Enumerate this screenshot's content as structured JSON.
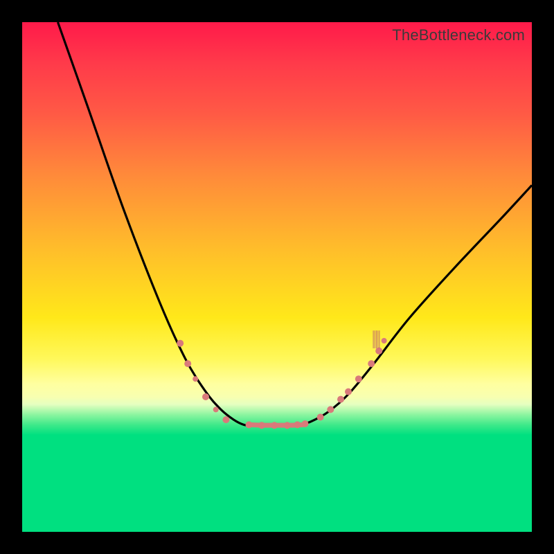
{
  "watermark": "TheBottleneck.com",
  "colors": {
    "gradient_top": "#ff1a4a",
    "gradient_mid": "#ffe81a",
    "gradient_bottom": "#00e080",
    "dot": "#d97a7a",
    "curve": "#000000",
    "frame": "#000000"
  },
  "chart_data": {
    "type": "line",
    "title": "",
    "xlabel": "",
    "ylabel": "",
    "xlim": [
      0,
      100
    ],
    "ylim": [
      0,
      100
    ],
    "note": "Axes are percentage of plot area: x left→right 0..100, y top→bottom 0..100. Higher y = lower on screen. V-shaped bottleneck curve; valley floor ≈ y 79.",
    "series": [
      {
        "name": "left-arm",
        "x": [
          7,
          13,
          20,
          27,
          32,
          36,
          39,
          41.5,
          43.5,
          45
        ],
        "y": [
          0,
          17,
          37,
          55,
          66,
          72.5,
          76,
          78,
          79,
          79
        ]
      },
      {
        "name": "valley-flat",
        "x": [
          45,
          47,
          49,
          51,
          53,
          55
        ],
        "y": [
          79,
          79.1,
          79.1,
          79.1,
          79.1,
          79
        ]
      },
      {
        "name": "right-arm",
        "x": [
          55,
          57,
          60,
          64,
          69,
          76,
          85,
          94,
          100
        ],
        "y": [
          79,
          78.2,
          76.5,
          73,
          67,
          58,
          48,
          38.5,
          32
        ]
      }
    ],
    "dots_left": [
      {
        "x": 31.0,
        "y": 63.0,
        "r": 5
      },
      {
        "x": 32.5,
        "y": 67.0,
        "r": 5
      },
      {
        "x": 34.0,
        "y": 70.0,
        "r": 4
      },
      {
        "x": 36.0,
        "y": 73.5,
        "r": 5
      },
      {
        "x": 38.0,
        "y": 76.0,
        "r": 4
      },
      {
        "x": 40.0,
        "y": 78.0,
        "r": 5
      }
    ],
    "dots_right": [
      {
        "x": 58.5,
        "y": 77.5,
        "r": 5
      },
      {
        "x": 60.5,
        "y": 76.0,
        "r": 5
      },
      {
        "x": 62.5,
        "y": 74.0,
        "r": 5
      },
      {
        "x": 64.0,
        "y": 72.5,
        "r": 5
      },
      {
        "x": 66.0,
        "y": 70.0,
        "r": 5
      },
      {
        "x": 68.5,
        "y": 67.0,
        "r": 5
      },
      {
        "x": 70.0,
        "y": 64.5,
        "r": 5
      },
      {
        "x": 71.0,
        "y": 62.5,
        "r": 4
      }
    ],
    "dots_valley": [
      {
        "x": 44.5,
        "y": 79.0,
        "r": 5
      },
      {
        "x": 47.0,
        "y": 79.1,
        "r": 5
      },
      {
        "x": 49.5,
        "y": 79.1,
        "r": 5
      },
      {
        "x": 52.0,
        "y": 79.1,
        "r": 5
      },
      {
        "x": 54.0,
        "y": 79.0,
        "r": 5
      },
      {
        "x": 55.5,
        "y": 78.8,
        "r": 5
      }
    ],
    "hash_cluster": {
      "x": 69.5,
      "y_top": 60.5,
      "y_bottom": 64.0,
      "count": 5
    }
  }
}
